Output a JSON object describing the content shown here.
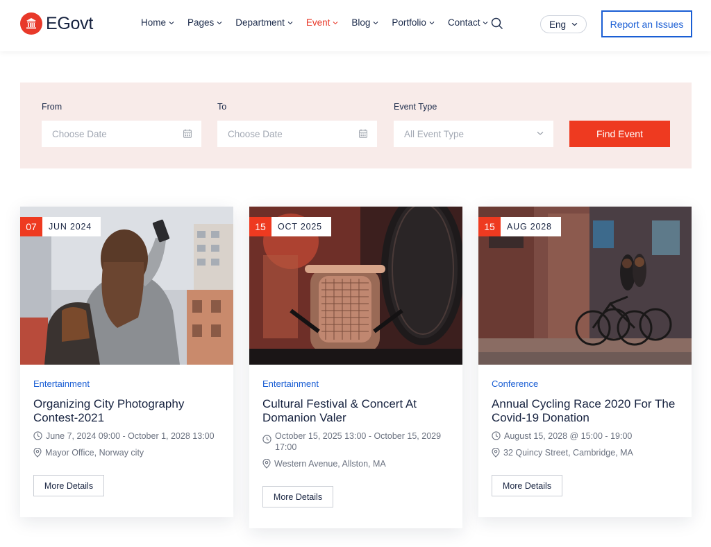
{
  "brand": {
    "name": "EGovt",
    "accent": "#e8392a",
    "primary": "#1a5ed4"
  },
  "nav": {
    "items": [
      {
        "label": "Home"
      },
      {
        "label": "Pages"
      },
      {
        "label": "Department"
      },
      {
        "label": "Event",
        "active": true
      },
      {
        "label": "Blog"
      },
      {
        "label": "Portfolio"
      },
      {
        "label": "Contact"
      }
    ],
    "language": "Eng",
    "report_button": "Report an Issues"
  },
  "filter": {
    "from_label": "From",
    "from_placeholder": "Choose Date",
    "to_label": "To",
    "to_placeholder": "Choose Date",
    "type_label": "Event Type",
    "type_selected": "All Event Type",
    "submit_label": "Find Event"
  },
  "events": [
    {
      "day": "07",
      "month_year": "JUN  2024",
      "category": "Entertainment",
      "title": "Organizing City Photography Contest-2021",
      "datetime": "June 7, 2024 09:00 - October 1, 2028 13:00",
      "location": "Mayor Office, Norway city",
      "button": "More Details",
      "image": "woman-photographing-city"
    },
    {
      "day": "15",
      "month_year": "OCT  2025",
      "category": "Entertainment",
      "title": "Cultural Festival & Concert At Domanion Valer",
      "datetime": "October 15, 2025 13:00 - October 15, 2029 17:00",
      "location": "Western Avenue, Allston, MA",
      "button": "More Details",
      "image": "studio-microphone"
    },
    {
      "day": "15",
      "month_year": "AUG  2028",
      "category": "Conference",
      "title": "Annual Cycling Race 2020 For The Covid-19 Donation",
      "datetime": "August 15, 2028 @ 15:00 - 19:00",
      "location": "32 Quincy Street, Cambridge, MA",
      "button": "More Details",
      "image": "cyclists-on-street"
    }
  ]
}
